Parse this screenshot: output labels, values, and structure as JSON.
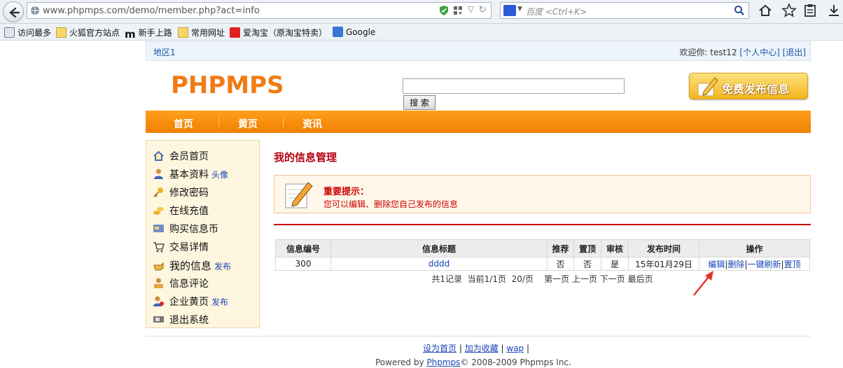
{
  "browser": {
    "url": "www.phpmps.com/demo/member.php?act=info",
    "search_placeholder": "百度 <Ctrl+K>"
  },
  "bookmarks": [
    {
      "label": "访问最多",
      "icon": "search-bookmark-icon"
    },
    {
      "label": "火狐官方站点",
      "icon": "folder-icon"
    },
    {
      "label": "新手上路",
      "icon": "m-logo-icon"
    },
    {
      "label": "常用网址",
      "icon": "folder-icon"
    },
    {
      "label": "爱淘宝（原淘宝特卖）",
      "icon": "taobao-icon"
    },
    {
      "label": "Google",
      "icon": "google-icon"
    }
  ],
  "topbar": {
    "region": "地区1",
    "welcome_prefix": "欢迎你: test12",
    "personal_center": "[个人中心]",
    "logout": "[退出]"
  },
  "header": {
    "logo": "PHPMPS",
    "search_button": "搜 索",
    "publish_button": "免费发布信息"
  },
  "nav": [
    "首页",
    "黄页",
    "资讯"
  ],
  "sidebar": [
    {
      "label": "会员首页",
      "icon": "home-icon",
      "extra": ""
    },
    {
      "label": "基本资料",
      "icon": "user-icon",
      "extra": "头像"
    },
    {
      "label": "修改密码",
      "icon": "key-icon",
      "extra": ""
    },
    {
      "label": "在线充值",
      "icon": "coins-icon",
      "extra": ""
    },
    {
      "label": "购买信息币",
      "icon": "card-icon",
      "extra": ""
    },
    {
      "label": "交易详情",
      "icon": "cart-icon",
      "extra": ""
    },
    {
      "label": "我的信息",
      "icon": "hand-icon",
      "extra": "发布"
    },
    {
      "label": "信息评论",
      "icon": "comment-icon",
      "extra": ""
    },
    {
      "label": "企业黄页",
      "icon": "company-icon",
      "extra": "发布"
    },
    {
      "label": "退出系统",
      "icon": "exit-icon",
      "extra": ""
    }
  ],
  "content": {
    "title": "我的信息管理",
    "notice_title": "重要提示：",
    "notice_text": "您可以编辑、删除您自己发布的信息"
  },
  "table": {
    "headers": [
      "信息编号",
      "信息标题",
      "推荐",
      "置顶",
      "审核",
      "发布时间",
      "操作"
    ],
    "rows": [
      {
        "id": "300",
        "title": "dddd",
        "recommend": "否",
        "top": "否",
        "audit": "是",
        "time": "15年01月29日",
        "op_edit": "编辑",
        "op_delete": "删除",
        "op_refresh": "一键刷新",
        "op_top": "置顶"
      }
    ]
  },
  "pager": "共1记录  当前1/1页  20/页    第一页 上一页 下一页 最后页",
  "footer": {
    "set_home": "设为首页",
    "add_fav": "加为收藏",
    "wap": "wap",
    "powered_prefix": "Powered by",
    "powered_link": "Phpmps",
    "copyright": "© 2008-2009 Phpmps Inc."
  },
  "colors": {
    "brand_orange": "#f08000",
    "title_red": "#b5000e",
    "link_blue": "#1a45b8"
  }
}
